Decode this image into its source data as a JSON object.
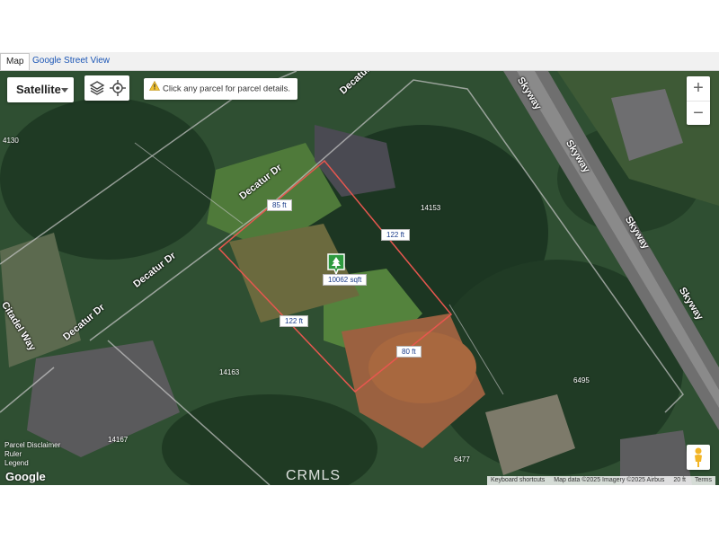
{
  "tabs": [
    {
      "label": "Map",
      "active": true
    },
    {
      "label": "Google Street View",
      "active": false
    }
  ],
  "map_type": {
    "selected": "Satellite"
  },
  "hint": {
    "text": "Click any parcel for parcel details."
  },
  "icons": {
    "layers": "layers-icon",
    "locate": "crosshair-icon",
    "warning": "warning-icon",
    "zoom_in": "plus-icon",
    "zoom_out": "minus-icon",
    "street_view": "pegman-icon",
    "parcel": "tree-pin-icon"
  },
  "zoom": {
    "in": "+",
    "out": "−"
  },
  "streets": {
    "decatur_top": "Decatur Dr",
    "decatur_mid": "Decatur Dr",
    "decatur_left": "Decatur Dr",
    "decatur_low": "Decatur Dr",
    "citadel": "Citadel Way",
    "skyway_1": "Skyway",
    "skyway_2": "Skyway",
    "skyway_3": "Skyway",
    "skyway_4": "Skyway"
  },
  "parcel_numbers": {
    "n4130": "4130",
    "n14153": "14153",
    "n14163": "14163",
    "n14167": "14167",
    "n6495": "6495",
    "n6477": "6477"
  },
  "parcel": {
    "area": "10062 sqft",
    "sides": {
      "north": "85 ft",
      "east": "122 ft",
      "west": "122 ft",
      "south": "80 ft"
    }
  },
  "legend": {
    "disclaimer": "Parcel Disclaimer",
    "ruler": "Ruler",
    "legend": "Legend"
  },
  "logo": "Google",
  "watermark": "CRMLS",
  "attribution": {
    "shortcuts": "Keyboard shortcuts",
    "data": "Map data ©2025 Imagery ©2025 Airbus",
    "scale": "20 ft",
    "terms": "Terms"
  },
  "colors": {
    "parcel_outline": "#e8574f",
    "accent": "#1a55b5",
    "pin": "#2e9a3f"
  }
}
